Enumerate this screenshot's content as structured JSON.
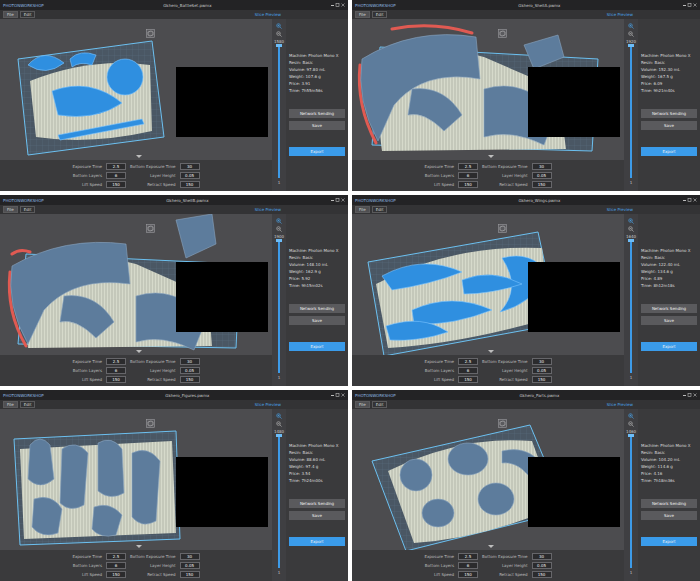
{
  "app": "PHOTONWORKSHOP",
  "windows": [
    {
      "title": "Gkhero_BattleSet.pwmx",
      "selected": true,
      "menu": [
        {
          "label": "File",
          "selected": true
        },
        {
          "label": "Edit",
          "selected": false
        }
      ],
      "link": "Slice Preview",
      "slider": {
        "max": "1580",
        "min": "1",
        "level": 1
      },
      "info": [
        "Machine: Photon Mono X",
        "Resin: Basic",
        "Volume: 97.80 mL",
        "Weight: 107.6 g",
        "Price: 3.91",
        "Time: 7h55m56s"
      ],
      "buttons": [
        "Network Sending",
        "Save"
      ],
      "primary": "Export",
      "params": [
        {
          "label": "Exposure Time",
          "value": "2.5"
        },
        {
          "label": "Bottom Exposure Time",
          "value": "30"
        },
        {
          "label": "Bottom Layers",
          "value": "6"
        },
        {
          "label": "Layer Height",
          "value": "0.05"
        },
        {
          "label": "Lift Speed",
          "value": "150"
        },
        {
          "label": "Retract Speed",
          "value": "150"
        }
      ]
    },
    {
      "title": "Gkhero_ShellA.pwmx",
      "selected": false,
      "menu": [
        {
          "label": "File",
          "selected": true
        },
        {
          "label": "Edit",
          "selected": false
        }
      ],
      "link": "Slice Preview",
      "slider": {
        "max": "1920",
        "min": "1",
        "level": 1
      },
      "info": [
        "Machine: Photon Mono X",
        "Resin: Basic",
        "Volume: 152.30 mL",
        "Weight: 167.5 g",
        "Price: 6.09",
        "Time: 9h21m40s"
      ],
      "buttons": [
        "Network Sending",
        "Save"
      ],
      "primary": "Export",
      "params": [
        {
          "label": "Exposure Time",
          "value": "2.5"
        },
        {
          "label": "Bottom Exposure Time",
          "value": "30"
        },
        {
          "label": "Bottom Layers",
          "value": "6"
        },
        {
          "label": "Layer Height",
          "value": "0.05"
        },
        {
          "label": "Lift Speed",
          "value": "150"
        },
        {
          "label": "Retract Speed",
          "value": "150"
        }
      ]
    },
    {
      "title": "Gkhero_ShellB.pwmx",
      "selected": false,
      "menu": [
        {
          "label": "File",
          "selected": true
        },
        {
          "label": "Edit",
          "selected": false
        }
      ],
      "link": "Slice Preview",
      "slider": {
        "max": "1900",
        "min": "1",
        "level": 1
      },
      "info": [
        "Machine: Photon Mono X",
        "Resin: Basic",
        "Volume: 148.10 mL",
        "Weight: 162.9 g",
        "Price: 5.92",
        "Time: 9h15m02s"
      ],
      "buttons": [
        "Network Sending",
        "Save"
      ],
      "primary": "Export",
      "params": [
        {
          "label": "Exposure Time",
          "value": "2.5"
        },
        {
          "label": "Bottom Exposure Time",
          "value": "30"
        },
        {
          "label": "Bottom Layers",
          "value": "6"
        },
        {
          "label": "Layer Height",
          "value": "0.05"
        },
        {
          "label": "Lift Speed",
          "value": "150"
        },
        {
          "label": "Retract Speed",
          "value": "150"
        }
      ]
    },
    {
      "title": "Gkhero_Wings.pwmx",
      "selected": true,
      "menu": [
        {
          "label": "File",
          "selected": true
        },
        {
          "label": "Edit",
          "selected": false
        }
      ],
      "link": "Slice Preview",
      "slider": {
        "max": "1640",
        "min": "1",
        "level": 1
      },
      "info": [
        "Machine: Photon Mono X",
        "Resin: Basic",
        "Volume: 122.40 mL",
        "Weight: 134.6 g",
        "Price: 4.89",
        "Time: 8h12m18s"
      ],
      "buttons": [
        "Network Sending",
        "Save"
      ],
      "primary": "Export",
      "params": [
        {
          "label": "Exposure Time",
          "value": "2.5"
        },
        {
          "label": "Bottom Exposure Time",
          "value": "30"
        },
        {
          "label": "Bottom Layers",
          "value": "6"
        },
        {
          "label": "Layer Height",
          "value": "0.05"
        },
        {
          "label": "Lift Speed",
          "value": "150"
        },
        {
          "label": "Retract Speed",
          "value": "150"
        }
      ]
    },
    {
      "title": "Gkhero_Figures.pwmx",
      "selected": false,
      "menu": [
        {
          "label": "File",
          "selected": true
        },
        {
          "label": "Edit",
          "selected": false
        }
      ],
      "link": "Slice Preview",
      "slider": {
        "max": "1480",
        "min": "1",
        "level": 1
      },
      "info": [
        "Machine: Photon Mono X",
        "Resin: Basic",
        "Volume: 88.60 mL",
        "Weight: 97.4 g",
        "Price: 3.54",
        "Time: 7h24m00s"
      ],
      "buttons": [
        "Network Sending",
        "Save"
      ],
      "primary": "Export",
      "params": [
        {
          "label": "Exposure Time",
          "value": "2.5"
        },
        {
          "label": "Bottom Exposure Time",
          "value": "30"
        },
        {
          "label": "Bottom Layers",
          "value": "6"
        },
        {
          "label": "Layer Height",
          "value": "0.05"
        },
        {
          "label": "Lift Speed",
          "value": "150"
        },
        {
          "label": "Retract Speed",
          "value": "150"
        }
      ]
    },
    {
      "title": "Gkhero_Parts.pwmx",
      "selected": false,
      "menu": [
        {
          "label": "File",
          "selected": true
        },
        {
          "label": "Edit",
          "selected": false
        }
      ],
      "link": "Slice Preview",
      "slider": {
        "max": "1460",
        "min": "1",
        "level": 1
      },
      "info": [
        "Machine: Photon Mono X",
        "Resin: Basic",
        "Volume: 104.20 mL",
        "Weight: 114.6 g",
        "Price: 4.16",
        "Time: 7h18m36s"
      ],
      "buttons": [
        "Network Sending",
        "Save"
      ],
      "primary": "Export",
      "params": [
        {
          "label": "Exposure Time",
          "value": "2.5"
        },
        {
          "label": "Bottom Exposure Time",
          "value": "30"
        },
        {
          "label": "Bottom Layers",
          "value": "6"
        },
        {
          "label": "Layer Height",
          "value": "0.05"
        },
        {
          "label": "Lift Speed",
          "value": "150"
        },
        {
          "label": "Retract Speed",
          "value": "150"
        }
      ]
    }
  ]
}
